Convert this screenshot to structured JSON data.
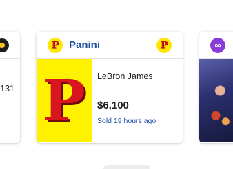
{
  "left_card": {
    "count_text": "131"
  },
  "main_card": {
    "brand": "Panini",
    "logo_letter": "P",
    "thumb_letter": "P",
    "player": "LeBron James",
    "price": "$6,100",
    "sold": "Sold 19 hours ago"
  },
  "right_card": {
    "logo_glyph": "∞"
  },
  "colors": {
    "brand_blue": "#1f4fa6",
    "panini_yellow": "#fff200",
    "panini_red": "#d9151f",
    "purple": "#8a3bd8"
  }
}
